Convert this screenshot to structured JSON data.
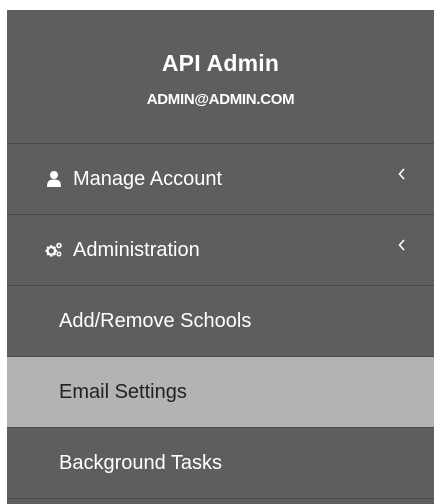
{
  "profile": {
    "name": "API Admin",
    "email": "ADMIN@ADMIN.COM"
  },
  "menu": {
    "manage_account": {
      "label": "Manage Account",
      "icon": "user-icon",
      "expand_icon": "chevron-left-icon"
    },
    "administration": {
      "label": "Administration",
      "icon": "cogs-icon",
      "expand_icon": "chevron-left-icon",
      "children": [
        {
          "label": "Add/Remove Schools",
          "active": false
        },
        {
          "label": "Email Settings",
          "active": true
        },
        {
          "label": "Background Tasks",
          "active": false
        }
      ]
    }
  },
  "colors": {
    "sidebar_bg": "#5e5e5e",
    "active_bg": "#b3b3b3",
    "text": "#ffffff",
    "active_text": "#222222",
    "divider": "#484848"
  }
}
